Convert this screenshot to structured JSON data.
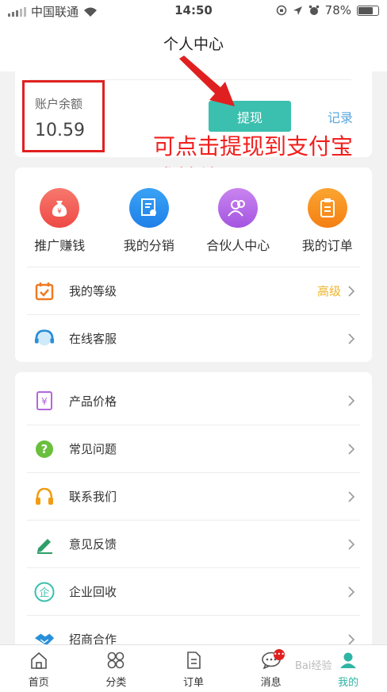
{
  "status_bar": {
    "carrier": "中国联通",
    "time": "14:50",
    "battery": "78%",
    "battery_level": 0.78
  },
  "header": {
    "title": "个人中心"
  },
  "balance": {
    "label": "账户余额",
    "value": "10.59",
    "withdraw_label": "提现",
    "record_label": "记录"
  },
  "annotation": {
    "text": "可点击提现到支付宝或其他"
  },
  "shortcuts": [
    {
      "label": "推广赚钱",
      "icon": "money-bag-icon",
      "color": "#f25a4f"
    },
    {
      "label": "我的分销",
      "icon": "certificate-icon",
      "color": "#2d8ff0"
    },
    {
      "label": "合伙人中心",
      "icon": "partners-icon",
      "color": "#b469e6"
    },
    {
      "label": "我的订单",
      "icon": "clipboard-icon",
      "color": "#f7941d"
    }
  ],
  "menu1": [
    {
      "label": "我的等级",
      "value": "高级",
      "icon": "calendar-check-icon"
    },
    {
      "label": "在线客服",
      "icon": "support-agent-icon"
    }
  ],
  "menu2": [
    {
      "label": "产品价格",
      "icon": "price-tag-icon"
    },
    {
      "label": "常见问题",
      "icon": "question-icon"
    },
    {
      "label": "联系我们",
      "icon": "headset-icon"
    },
    {
      "label": "意见反馈",
      "icon": "pencil-icon"
    },
    {
      "label": "企业回收",
      "icon": "enterprise-icon"
    },
    {
      "label": "招商合作",
      "icon": "handshake-icon"
    }
  ],
  "tabbar": [
    {
      "label": "首页",
      "icon": "home-icon"
    },
    {
      "label": "分类",
      "icon": "category-icon"
    },
    {
      "label": "订单",
      "icon": "order-icon"
    },
    {
      "label": "消息",
      "icon": "message-icon",
      "badge": "•••"
    },
    {
      "label": "我的",
      "icon": "profile-icon",
      "active": true
    }
  ],
  "watermark": "Bai经验"
}
